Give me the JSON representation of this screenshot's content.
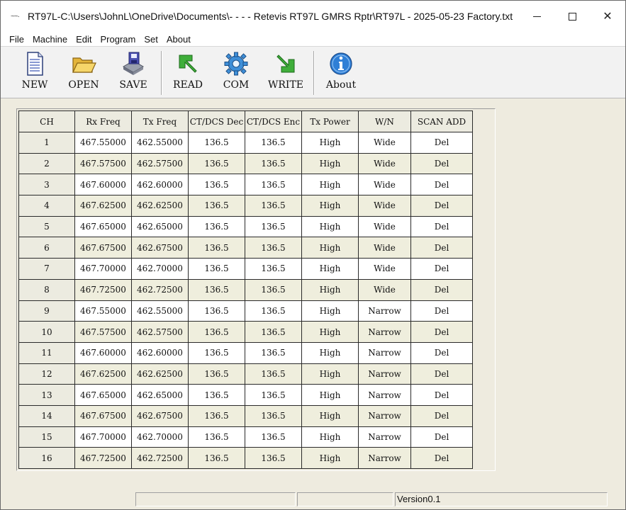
{
  "window": {
    "title": "RT97L-C:\\Users\\JohnL\\OneDrive\\Documents\\- - - - Retevis RT97L GMRS Rptr\\RT97L - 2025-05-23   Factory.txt",
    "icon": "app-icon",
    "controls": {
      "minimize": "minimize-icon",
      "maximize": "maximize-icon",
      "close": "✕"
    }
  },
  "menu": [
    "File",
    "Machine",
    "Edit",
    "Program",
    "Set",
    "About"
  ],
  "toolbar": {
    "new": "NEW",
    "open": "OPEN",
    "save": "SAVE",
    "read": "READ",
    "com": "COM",
    "write": "WRITE",
    "about": "About"
  },
  "colors": {
    "window_bg": "#eeebdf",
    "row_white": "#ffffff",
    "row_tint": "#efeedd",
    "grid_line": "#2a2a2a"
  },
  "grid": {
    "headers": [
      "CH",
      "Rx Freq",
      "Tx Freq",
      "CT/DCS Dec",
      "CT/DCS Enc",
      "Tx Power",
      "W/N",
      "SCAN ADD"
    ],
    "rows": [
      [
        "1",
        "467.55000",
        "462.55000",
        "136.5",
        "136.5",
        "High",
        "Wide",
        "Del"
      ],
      [
        "2",
        "467.57500",
        "462.57500",
        "136.5",
        "136.5",
        "High",
        "Wide",
        "Del"
      ],
      [
        "3",
        "467.60000",
        "462.60000",
        "136.5",
        "136.5",
        "High",
        "Wide",
        "Del"
      ],
      [
        "4",
        "467.62500",
        "462.62500",
        "136.5",
        "136.5",
        "High",
        "Wide",
        "Del"
      ],
      [
        "5",
        "467.65000",
        "462.65000",
        "136.5",
        "136.5",
        "High",
        "Wide",
        "Del"
      ],
      [
        "6",
        "467.67500",
        "462.67500",
        "136.5",
        "136.5",
        "High",
        "Wide",
        "Del"
      ],
      [
        "7",
        "467.70000",
        "462.70000",
        "136.5",
        "136.5",
        "High",
        "Wide",
        "Del"
      ],
      [
        "8",
        "467.72500",
        "462.72500",
        "136.5",
        "136.5",
        "High",
        "Wide",
        "Del"
      ],
      [
        "9",
        "467.55000",
        "462.55000",
        "136.5",
        "136.5",
        "High",
        "Narrow",
        "Del"
      ],
      [
        "10",
        "467.57500",
        "462.57500",
        "136.5",
        "136.5",
        "High",
        "Narrow",
        "Del"
      ],
      [
        "11",
        "467.60000",
        "462.60000",
        "136.5",
        "136.5",
        "High",
        "Narrow",
        "Del"
      ],
      [
        "12",
        "467.62500",
        "462.62500",
        "136.5",
        "136.5",
        "High",
        "Narrow",
        "Del"
      ],
      [
        "13",
        "467.65000",
        "462.65000",
        "136.5",
        "136.5",
        "High",
        "Narrow",
        "Del"
      ],
      [
        "14",
        "467.67500",
        "462.67500",
        "136.5",
        "136.5",
        "High",
        "Narrow",
        "Del"
      ],
      [
        "15",
        "467.70000",
        "462.70000",
        "136.5",
        "136.5",
        "High",
        "Narrow",
        "Del"
      ],
      [
        "16",
        "467.72500",
        "462.72500",
        "136.5",
        "136.5",
        "High",
        "Narrow",
        "Del"
      ]
    ]
  },
  "statusbar": {
    "version": "Version0.1"
  }
}
